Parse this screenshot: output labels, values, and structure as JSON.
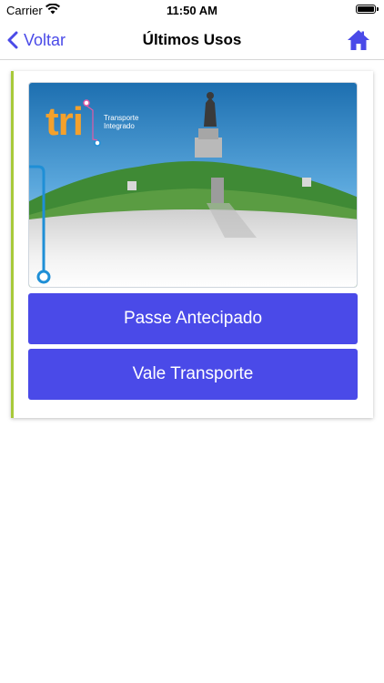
{
  "status_bar": {
    "carrier": "Carrier",
    "time": "11:50 AM",
    "battery_level": 1.0
  },
  "nav": {
    "back_label": "Voltar",
    "title": "Últimos Usos",
    "home_icon": "home-icon",
    "back_icon": "chevron-left-icon"
  },
  "card": {
    "logo": {
      "brand": "tri",
      "subtitle_line1": "Transporte",
      "subtitle_line2": "Integrado"
    },
    "buttons": {
      "passe_label": "Passe Antecipado",
      "vale_label": "Vale Transporte"
    }
  },
  "colors": {
    "accent": "#4a4ae8",
    "card_border": "#a8c93a",
    "logo_orange": "#f4a12c",
    "line_blue": "#1f8fd6"
  }
}
